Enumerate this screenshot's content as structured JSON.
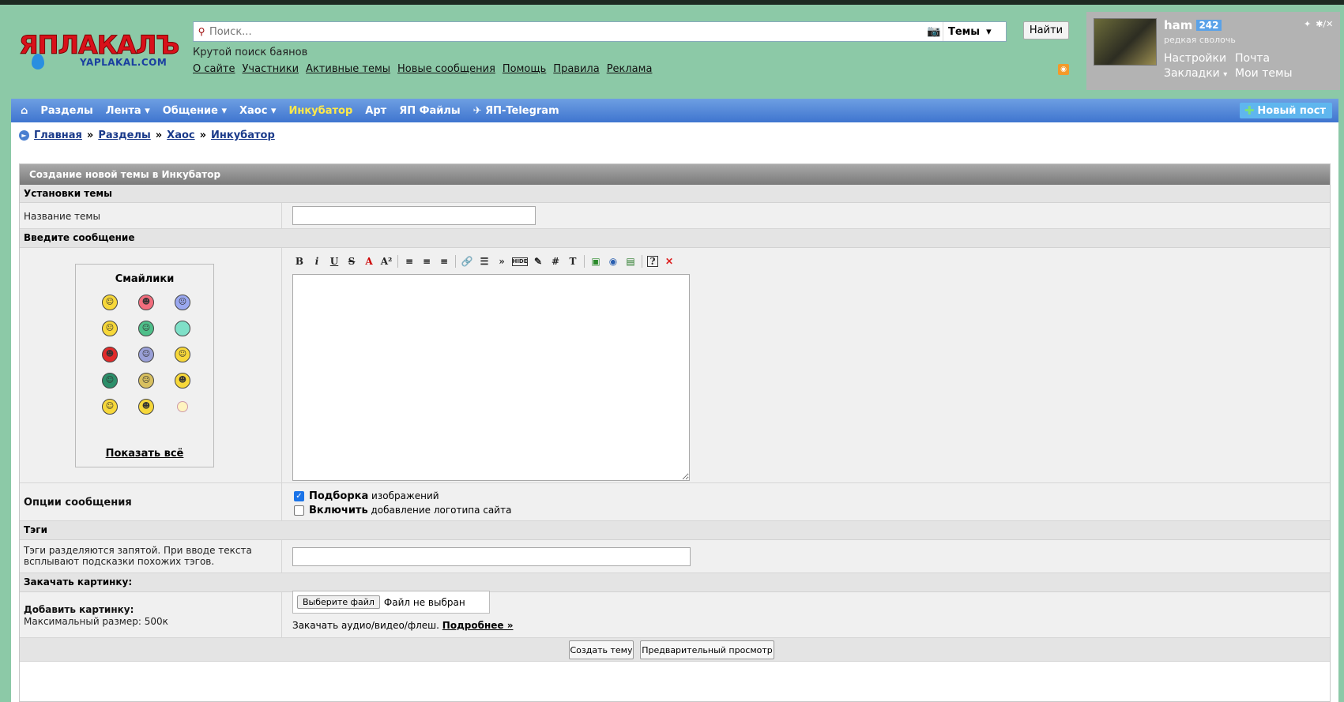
{
  "logo": {
    "main": "ЯПЛАКАЛЪ",
    "sub": "YAPLAKAL.COM"
  },
  "search": {
    "placeholder": "Поиск...",
    "scope": "Темы",
    "button": "Найти"
  },
  "tagline": "Крутой поиск баянов",
  "top_links": [
    "О сайте",
    "Участники",
    "Активные темы",
    "Новые сообщения",
    "Помощь",
    "Правила",
    "Реклама"
  ],
  "user": {
    "name": "ham",
    "count": "242",
    "rank": "редкая сволочь",
    "links": [
      "Настройки",
      "Почта",
      "Закладки",
      "Мои темы"
    ],
    "corner": [
      "✦",
      "✱/✕"
    ]
  },
  "nav": {
    "home": "⌂",
    "items": [
      "Разделы",
      "Лента ▾",
      "Общение ▾",
      "Хаос ▾",
      "Инкубатор",
      "Арт",
      "ЯП Файлы",
      "✈ ЯП-Telegram"
    ],
    "active": "Инкубатор",
    "new_post": "Новый пост"
  },
  "breadcrumbs": [
    "Главная",
    "Разделы",
    "Хаос",
    "Инкубатор"
  ],
  "form": {
    "title": "Создание новой темы в Инкубатор",
    "s_topic": "Установки темы",
    "topic_name_label": "Название темы",
    "s_message": "Введите сообщение",
    "smilies_title": "Смайлики",
    "smilies_show_all": "Показать всё",
    "options_label": "Опции сообщения",
    "opt1_bold": "Подборка",
    "opt1_rest": " изображений",
    "opt2_bold": "Включить",
    "opt2_rest": " добавление логотипа сайта",
    "s_tags": "Тэги",
    "tags_hint": "Тэги разделяются запятой. При вводе текста всплывают подсказки похожих тэгов.",
    "s_upload": "Закачать картинку:",
    "add_pic_label": "Добавить картинку:",
    "max_size": "Максимальный размер: 500к",
    "file_button": "Выберите файл",
    "file_none": "Файл не выбран",
    "media_note": "Закачать аудио/видео/флеш.",
    "media_more": "Подробнее »",
    "submit": "Создать тему",
    "preview": "Предварительный просмотр"
  },
  "toolbar": [
    "B",
    "i",
    "U",
    "S",
    "A",
    "A²",
    "≡",
    "≡",
    "≡",
    "🔗",
    "☰",
    "»",
    "HIDE",
    "✎",
    "#",
    "T",
    "▣",
    "◉",
    "▤",
    "?",
    "✕"
  ]
}
